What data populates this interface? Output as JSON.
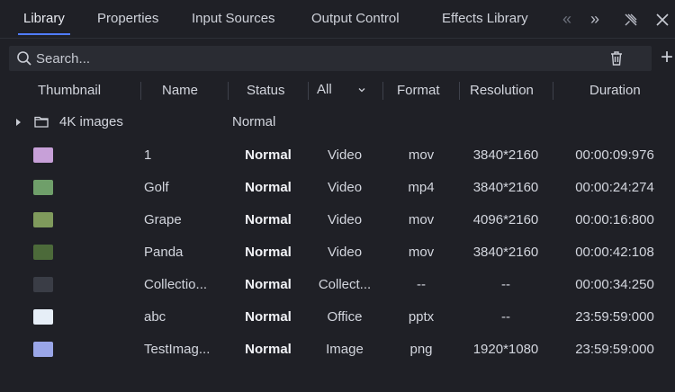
{
  "tabs": [
    {
      "label": "Library",
      "active": true
    },
    {
      "label": "Properties",
      "active": false
    },
    {
      "label": "Input Sources",
      "active": false
    },
    {
      "label": "Output Control",
      "active": false
    },
    {
      "label": "Effects Library",
      "active": false
    }
  ],
  "toolbar_icons": [
    "chevron-double-left-icon",
    "chevron-double-right-icon",
    "unpin-icon",
    "close-icon"
  ],
  "search": {
    "placeholder": "Search..."
  },
  "columns": {
    "thumbnail": "Thumbnail",
    "name": "Name",
    "status": "Status",
    "type_filter": "All",
    "format": "Format",
    "resolution": "Resolution",
    "duration": "Duration"
  },
  "folder": {
    "name": "4K images",
    "status": "Normal"
  },
  "rows": [
    {
      "name": "1",
      "status": "Normal",
      "type": "Video",
      "format": "mov",
      "resolution": "3840*2160",
      "duration": "00:00:09:976",
      "thumb_color": "#c7a0d8"
    },
    {
      "name": "Golf",
      "status": "Normal",
      "type": "Video",
      "format": "mp4",
      "resolution": "3840*2160",
      "duration": "00:00:24:274",
      "thumb_color": "#6f9f6a"
    },
    {
      "name": "Grape",
      "status": "Normal",
      "type": "Video",
      "format": "mov",
      "resolution": "4096*2160",
      "duration": "00:00:16:800",
      "thumb_color": "#7f9a5c"
    },
    {
      "name": "Panda",
      "status": "Normal",
      "type": "Video",
      "format": "mov",
      "resolution": "3840*2160",
      "duration": "00:00:42:108",
      "thumb_color": "#4c6a3a"
    },
    {
      "name": "Collectio...",
      "status": "Normal",
      "type": "Collect...",
      "format": "--",
      "resolution": "--",
      "duration": "00:00:34:250",
      "thumb_color": "#3a3d46"
    },
    {
      "name": "abc",
      "status": "Normal",
      "type": "Office",
      "format": "pptx",
      "resolution": "--",
      "duration": "23:59:59:000",
      "thumb_color": "#e6eef7"
    },
    {
      "name": "TestImag...",
      "status": "Normal",
      "type": "Image",
      "format": "png",
      "resolution": "1920*1080",
      "duration": "23:59:59:000",
      "thumb_color": "#9aa6e8"
    }
  ],
  "colors": {
    "background": "#1f2026",
    "accent": "#4f7cff",
    "search_bg": "#2a2c33"
  }
}
